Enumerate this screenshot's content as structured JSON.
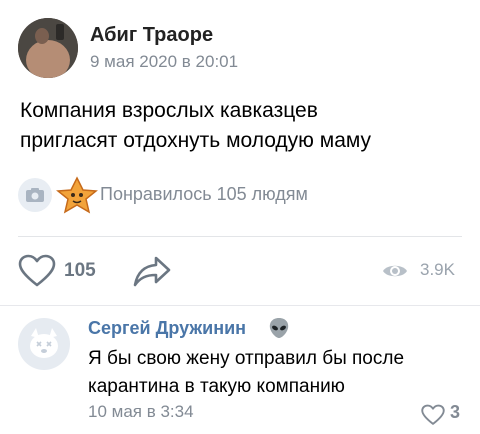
{
  "post": {
    "author": "Абиг Траоре",
    "date": "9 мая 2020 в 20:01",
    "text": "Компания взрослых кавказцев\nпригласят отдохнуть молодую маму",
    "liked_by": "Понравилось 105 людям",
    "likes": "105",
    "views": "3.9K"
  },
  "comment": {
    "author": "Сергей Дружинин",
    "text": "Я бы свою жену отправил бы после\nкарантина в такую компанию",
    "date": "10 мая в 3:34",
    "likes": "3"
  },
  "colors": {
    "link_blue": "#4a76a8",
    "secondary_gray": "#828a94",
    "icon_gray": "#6b7682"
  },
  "icons": [
    "camera-icon",
    "star-sticker-icon",
    "heart-icon",
    "share-icon",
    "eye-icon",
    "alien-icon",
    "dog-avatar-icon"
  ]
}
